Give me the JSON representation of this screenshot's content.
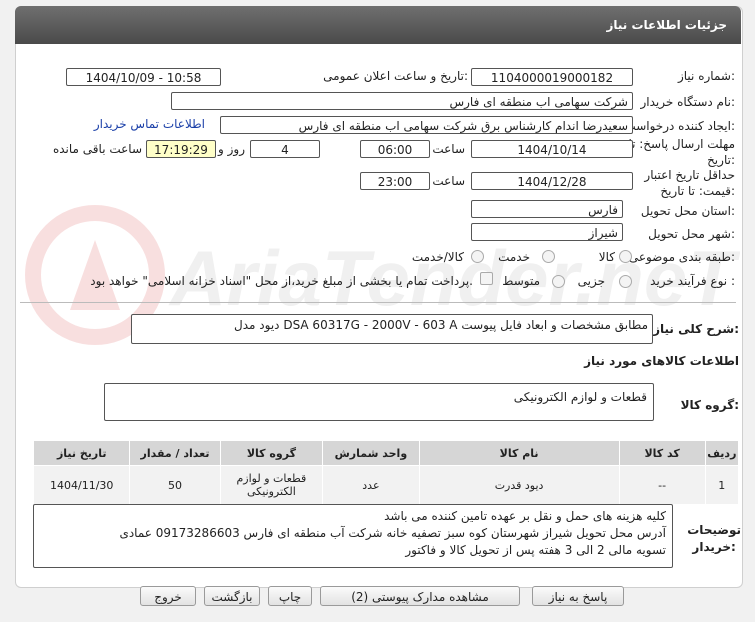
{
  "header": {
    "title": "جزئیات اطلاعات نیاز"
  },
  "fields": {
    "need_number_label": "شماره نیاز:",
    "need_number": "1104000019000182",
    "announce_label": "تاریخ و ساعت اعلان عمومی:",
    "announce_value": "1404/10/09 - 10:58",
    "buyer_org_label": "نام دستگاه خریدار:",
    "buyer_org": "شرکت سهامی اب منطقه ای فارس",
    "creator_label": "ایجاد کننده درخواست:",
    "creator": "سعیدرضا اندام کارشناس برق شرکت سهامی اب منطقه ای فارس",
    "contact_link": "اطلاعات تماس خریدار",
    "deadline_label": "مهلت ارسال پاسخ: تا تاریخ:",
    "deadline_date": "1404/10/14",
    "time_label": "ساعت",
    "deadline_time": "06:00",
    "days_value": "4",
    "days_label": "روز و",
    "remaining_time": "17:19:29",
    "remaining_label": "ساعت باقی مانده",
    "validity_label": "حداقل تاریخ اعتبار قیمت: تا تاریخ:",
    "validity_date": "1404/12/28",
    "validity_time": "23:00",
    "province_label": "استان محل تحویل:",
    "province": "فارس",
    "city_label": "شهر محل تحویل:",
    "city": "شیراز",
    "category_label": "طبقه بندی موضوعی:",
    "category_options": [
      "کالا",
      "خدمت",
      "کالا/خدمت"
    ],
    "process_label": "نوع فرآیند خرید :",
    "process_options": [
      "جزیی",
      "متوسط"
    ],
    "payment_note": "پرداخت تمام یا بخشی از مبلغ خرید،از محل \"اسناد خزانه اسلامی\" خواهد بود."
  },
  "summary": {
    "label": "شرح کلی نیاز:",
    "text": "دیود مدل DSA 60317G - 2000V - 603 A مطابق مشخصات و ابعاد فایل پیوست"
  },
  "goods": {
    "section_title": "اطلاعات کالاهای مورد نیاز",
    "group_label": "گروه کالا:",
    "group_value": "قطعات و لوازم الکترونیکی",
    "columns": [
      "ردیف",
      "کد کالا",
      "نام کالا",
      "واحد شمارش",
      "تعداد / مقدار",
      "تاریخ نیاز"
    ],
    "rows": [
      {
        "row": "1",
        "code": "--",
        "name": "دیود قدرت",
        "unit": "عدد",
        "qty": "50",
        "date": "1404/11/30",
        "group_line1": "قطعات و لوازم",
        "group_line2": "الکترونیکی"
      }
    ]
  },
  "notes": {
    "label_line1": "توضیحات",
    "label_line2": "خریدار:",
    "line1": "کلیه هزینه های حمل و نقل بر عهده تامین کننده می باشد",
    "line2": "آدرس محل تحویل شیراز شهرستان کوه سبز تصفیه خانه شرکت آب منطقه ای فارس 09173286603 عمادی",
    "line3": "تسویه مالی 2 الی 3 هفته پس از تحویل کالا و فاکتور"
  },
  "buttons": {
    "reply": "پاسخ به نیاز",
    "docs": "مشاهده مدارک پیوستی (2)",
    "print": "چاپ",
    "back": "بازگشت",
    "exit": "خروج"
  },
  "colors": {
    "header": "#5a5a5a",
    "time_highlight": "#ffffc8",
    "link": "#1a3fa8"
  }
}
